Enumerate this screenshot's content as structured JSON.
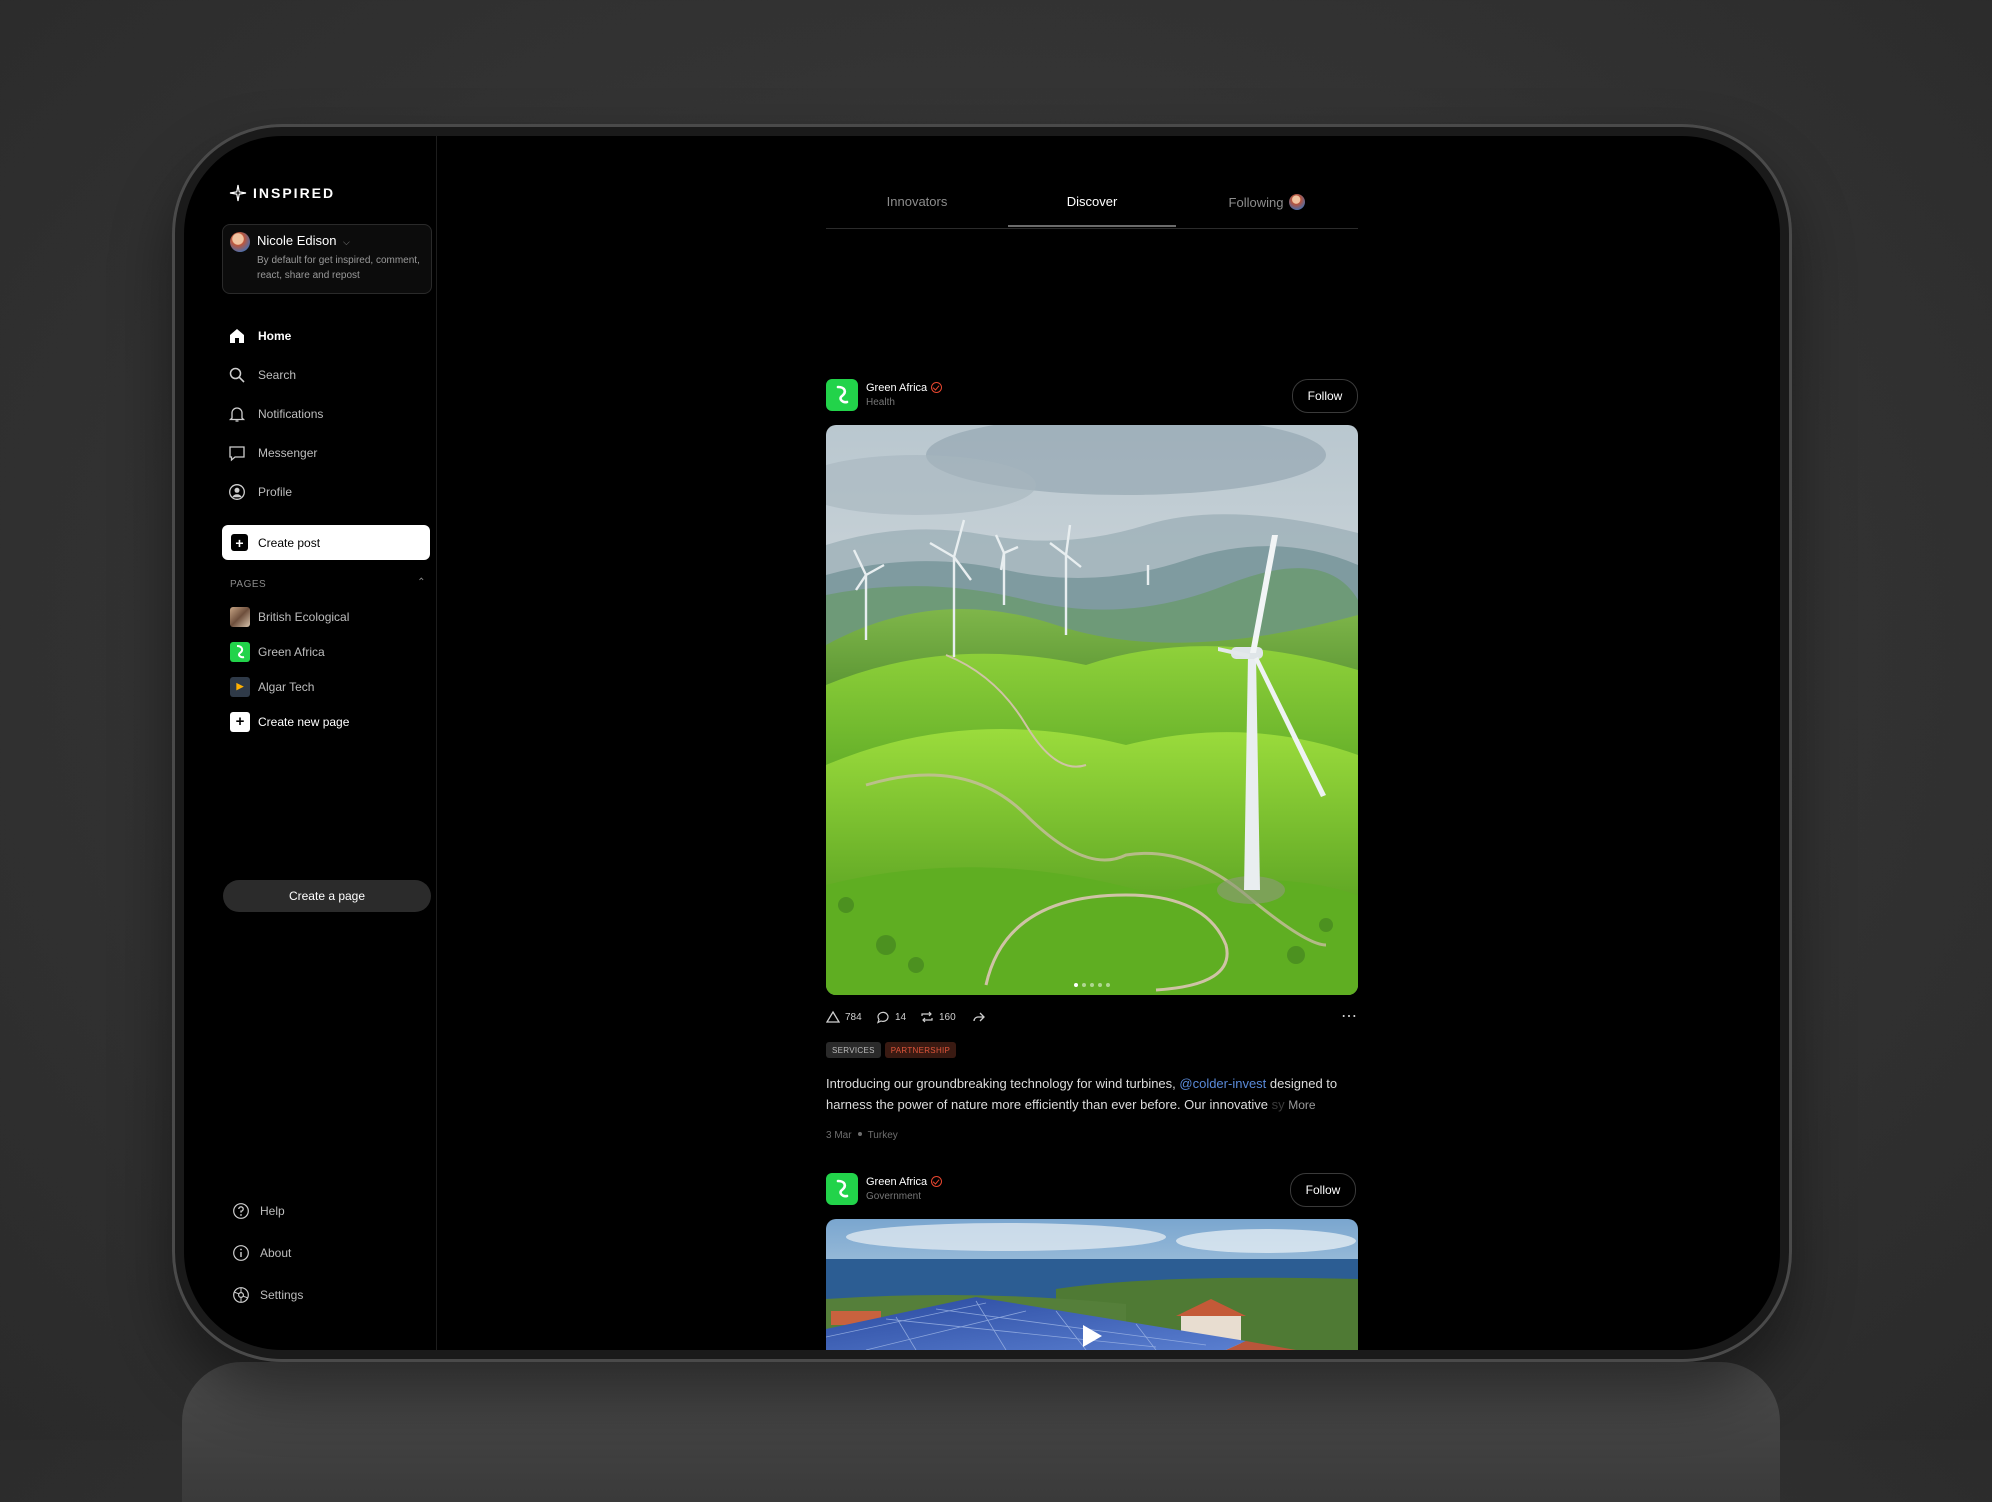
{
  "app": {
    "brand": "INSPIRED"
  },
  "user": {
    "name": "Nicole Edison",
    "description": "By default for get inspired, comment, react, share and repost"
  },
  "nav": [
    {
      "label": "Home",
      "icon": "home-icon"
    },
    {
      "label": "Search",
      "icon": "search-icon"
    },
    {
      "label": "Notifications",
      "icon": "bell-icon"
    },
    {
      "label": "Messenger",
      "icon": "chat-icon"
    },
    {
      "label": "Profile",
      "icon": "profile-icon"
    }
  ],
  "create_post_label": "Create post",
  "pages_section": {
    "title": "PAGES",
    "items": [
      {
        "label": "British Ecological"
      },
      {
        "label": "Green Africa"
      },
      {
        "label": "Algar Tech"
      },
      {
        "label": "Create new page"
      }
    ],
    "create_page_label": "Create a page"
  },
  "bottom_nav": [
    {
      "label": "Help",
      "icon": "help-icon"
    },
    {
      "label": "About",
      "icon": "info-icon"
    },
    {
      "label": "Settings",
      "icon": "settings-icon"
    }
  ],
  "tabs": [
    {
      "label": "Innovators"
    },
    {
      "label": "Discover",
      "active": true
    },
    {
      "label": "Following"
    }
  ],
  "posts": [
    {
      "author": "Green Africa",
      "category": "Health",
      "follow_label": "Follow",
      "stats": {
        "likes": "784",
        "comments": "14",
        "reposts": "160"
      },
      "tags": [
        "SERVICES",
        "PARTNERSHIP"
      ],
      "text_before": "Introducing our groundbreaking technology for wind turbines, ",
      "mention": "@colder-invest",
      "text_after": " designed to harness the power of nature more efficiently than ever before. Our innovative ",
      "text_faded": "sy",
      "more_label": "More",
      "date": "3 Mar",
      "location": "Turkey"
    },
    {
      "author": "Green Africa",
      "category": "Government",
      "follow_label": "Follow"
    }
  ],
  "colors": {
    "accent_green": "#22d34a",
    "verified_red": "#e7462f",
    "mention_blue": "#5a8ad8"
  }
}
